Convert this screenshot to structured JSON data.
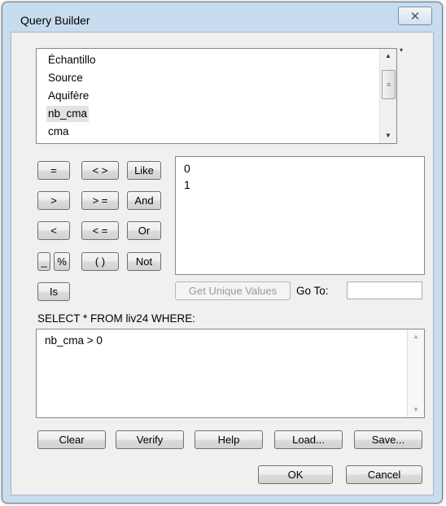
{
  "window": {
    "title": "Query Builder",
    "close_glyph": "✕"
  },
  "fields": {
    "items": [
      {
        "label": "Échantillo",
        "selected": false
      },
      {
        "label": "Source",
        "selected": false
      },
      {
        "label": "Aquifère",
        "selected": false
      },
      {
        "label": "nb_cma",
        "selected": true
      },
      {
        "label": "cma",
        "selected": false
      }
    ]
  },
  "operators": {
    "eq": "=",
    "ne": "< >",
    "like": "Like",
    "gt": ">",
    "ge": "> =",
    "and": "And",
    "lt": "<",
    "le": "< =",
    "or": "Or",
    "underscore": "_",
    "percent": "%",
    "parens": "( )",
    "not": "Not",
    "is": "Is"
  },
  "values": {
    "items": [
      "0",
      "1"
    ]
  },
  "unique_values": {
    "button": "Get Unique Values",
    "goto_label": "Go To:",
    "goto_value": ""
  },
  "sql": {
    "prefix": "SELECT * FROM liv24 WHERE:",
    "expression": "nb_cma > 0"
  },
  "actions": {
    "clear": "Clear",
    "verify": "Verify",
    "help": "Help",
    "load": "Load...",
    "save": "Save...",
    "ok": "OK",
    "cancel": "Cancel"
  },
  "icons": {
    "scroll_up": "▲",
    "scroll_down": "▼",
    "grip": "≡",
    "side_marker": "▾"
  },
  "colors": {
    "frame": "#c8dcf0",
    "client": "#f0f0f0",
    "selection": "#e3e3e3"
  }
}
